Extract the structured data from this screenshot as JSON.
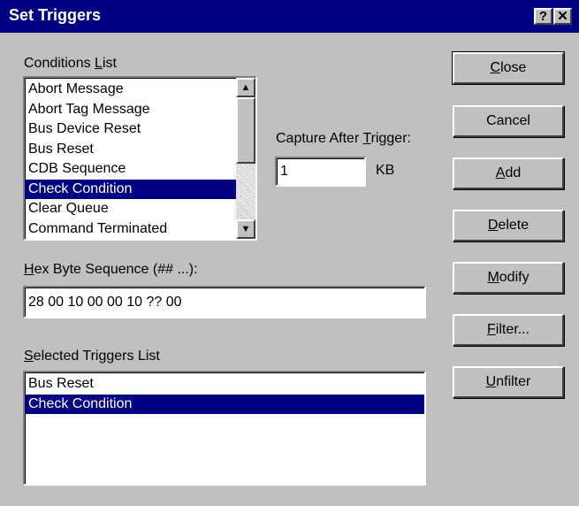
{
  "window": {
    "title": "Set Triggers",
    "help_label": "?",
    "close_label": "✕"
  },
  "conditions": {
    "label_accel": "",
    "label_pre": "Conditions ",
    "label_u": "L",
    "label_post": "ist",
    "items": [
      "Abort Message",
      "Abort Tag Message",
      "Bus Device Reset",
      "Bus Reset",
      "CDB Sequence",
      "Check Condition",
      "Clear Queue",
      "Command Terminated"
    ],
    "selected_index": 5,
    "scroll_up": "▲",
    "scroll_down": "▼"
  },
  "capture": {
    "label_pre": "Capture After ",
    "label_u": "T",
    "label_post": "rigger:",
    "value": "1",
    "unit": "KB"
  },
  "hex": {
    "label_u": "H",
    "label_post": "ex Byte Sequence (## ...):",
    "value": "28 00 10 00 00 10 ?? 00"
  },
  "selected_triggers": {
    "label_u": "S",
    "label_post": "elected Triggers List",
    "items": [
      "Bus Reset",
      "Check Condition"
    ],
    "selected_index": 1
  },
  "buttons": {
    "close": {
      "u": "C",
      "rest": "lose"
    },
    "cancel": {
      "u": "",
      "rest": "Cancel"
    },
    "add": {
      "u": "A",
      "rest": "dd"
    },
    "delete": {
      "u": "D",
      "rest": "elete"
    },
    "modify": {
      "u": "M",
      "rest": "odify"
    },
    "filter": {
      "u": "F",
      "rest": "ilter..."
    },
    "unfilter": {
      "u": "U",
      "rest": "nfilter"
    }
  }
}
